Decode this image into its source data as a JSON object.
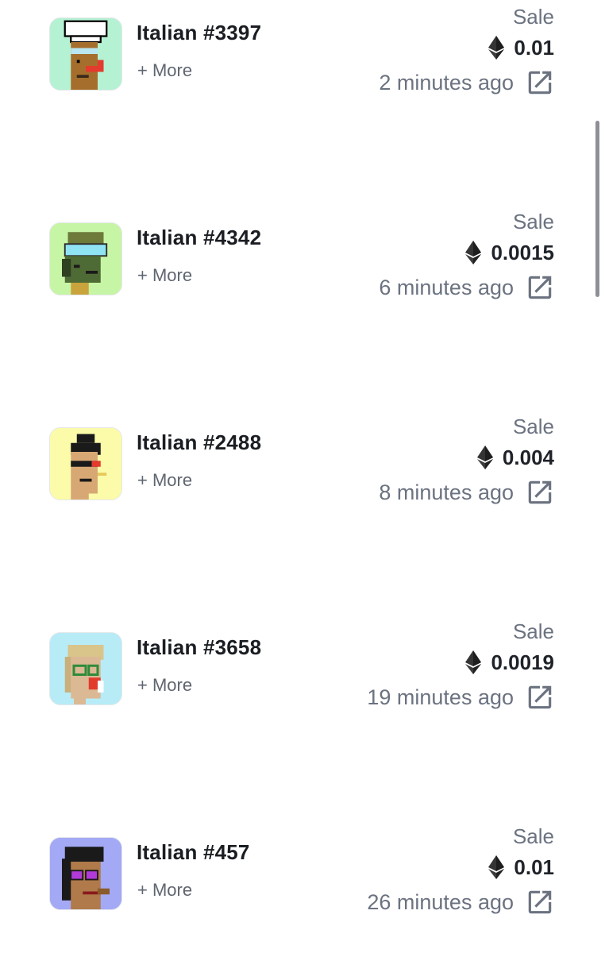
{
  "sales": [
    {
      "name": "Italian #3397",
      "more": "+ More",
      "kind": "Sale",
      "price": "0.01",
      "time": "2 minutes ago",
      "bg": "#b5f2d3",
      "avatar": "chef"
    },
    {
      "name": "Italian #4342",
      "more": "+ More",
      "kind": "Sale",
      "price": "0.0015",
      "time": "6 minutes ago",
      "bg": "#c7f5a6",
      "avatar": "goggles"
    },
    {
      "name": "Italian #2488",
      "more": "+ More",
      "kind": "Sale",
      "price": "0.004",
      "time": "8 minutes ago",
      "bg": "#fbfbaa",
      "avatar": "mohawk"
    },
    {
      "name": "Italian #3658",
      "more": "+ More",
      "kind": "Sale",
      "price": "0.0019",
      "time": "19 minutes ago",
      "bg": "#b7ecf7",
      "avatar": "blonde"
    },
    {
      "name": "Italian #457",
      "more": "+ More",
      "kind": "Sale",
      "price": "0.01",
      "time": "26 minutes ago",
      "bg": "#a3a9f5",
      "avatar": "shades"
    }
  ],
  "icons": {
    "currency": "ethereum-icon",
    "link": "external-link-icon"
  },
  "colors": {
    "title": "#1a1d22",
    "muted": "#6b7280",
    "scrollbar": "#8d9095"
  }
}
